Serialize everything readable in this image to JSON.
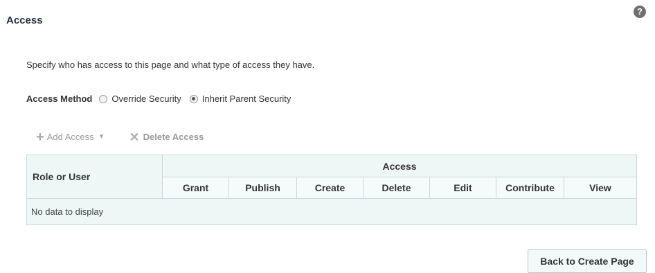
{
  "header": {
    "title": "Access",
    "help_glyph": "?"
  },
  "description": "Specify who has access to this page and what type of access they have.",
  "access_method": {
    "label": "Access Method",
    "options": [
      {
        "label": "Override Security",
        "selected": false
      },
      {
        "label": "Inherit Parent Security",
        "selected": true
      }
    ]
  },
  "toolbar": {
    "add_label": "Add Access",
    "add_icon": "plus-icon",
    "delete_label": "Delete Access",
    "delete_icon": "x-icon",
    "disabled_color": "#9a9a9a"
  },
  "table": {
    "role_header": "Role or User",
    "access_header": "Access",
    "columns": [
      "Grant",
      "Publish",
      "Create",
      "Delete",
      "Edit",
      "Contribute",
      "View"
    ],
    "empty_text": "No data to display",
    "header_bg": "#eef6f6"
  },
  "footer": {
    "back_label": "Back to Create Page"
  }
}
